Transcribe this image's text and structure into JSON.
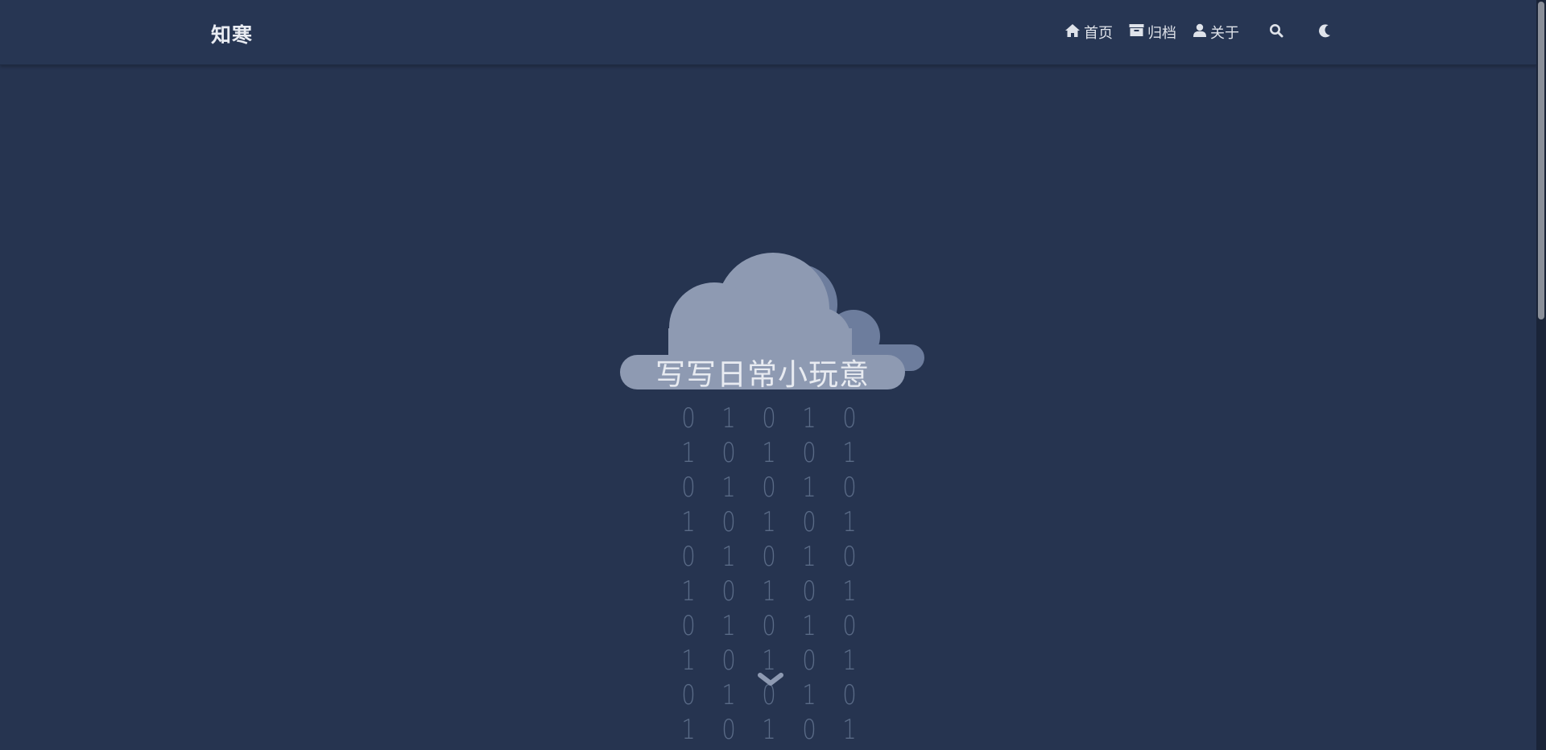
{
  "header": {
    "brand": "知寒",
    "nav": [
      {
        "label": "首页",
        "icon": "home-icon"
      },
      {
        "label": "归档",
        "icon": "archive-icon"
      },
      {
        "label": "关于",
        "icon": "user-icon"
      }
    ],
    "search_icon": "search-icon",
    "theme_icon": "moon-icon"
  },
  "hero": {
    "tagline": "写写日常小玩意",
    "binary_rows": [
      [
        "0",
        "1",
        "0",
        "1",
        "0"
      ],
      [
        "1",
        "0",
        "1",
        "0",
        "1"
      ],
      [
        "0",
        "1",
        "0",
        "1",
        "0"
      ],
      [
        "1",
        "0",
        "1",
        "0",
        "1"
      ],
      [
        "0",
        "1",
        "0",
        "1",
        "0"
      ],
      [
        "1",
        "0",
        "1",
        "0",
        "1"
      ],
      [
        "0",
        "1",
        "0",
        "1",
        "0"
      ],
      [
        "1",
        "0",
        "1",
        "0",
        "1"
      ],
      [
        "0",
        "1",
        "0",
        "1",
        "0"
      ],
      [
        "1",
        "0",
        "1",
        "0",
        "1"
      ]
    ],
    "scroll_icon": "chevron-down-icon"
  },
  "colors": {
    "background": "#263450",
    "cloud_front": "#8e9ab2",
    "cloud_back": "#6d7d9d",
    "binary_text": "#5a6b87"
  }
}
